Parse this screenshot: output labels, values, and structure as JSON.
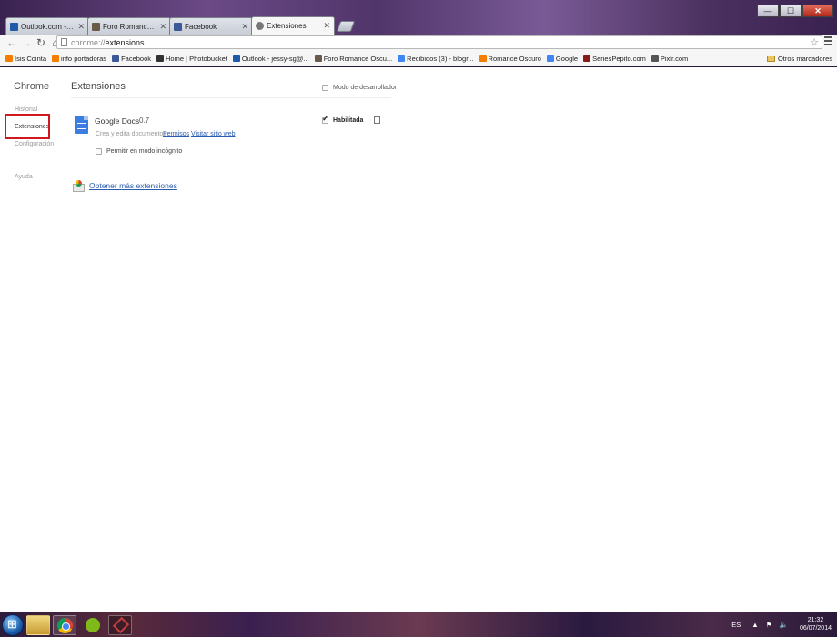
{
  "window": {
    "controls": [
      "—",
      "☐",
      "✕"
    ]
  },
  "tabs": [
    {
      "title": "Outlook.com - jessy-sg@...",
      "icon": "outlook-icon",
      "color": "#1e5aa8",
      "active": false
    },
    {
      "title": "Foro Romance Oscuro - N...",
      "icon": "forum-icon",
      "color": "#6a5a4a",
      "active": false
    },
    {
      "title": "Facebook",
      "icon": "facebook-icon",
      "color": "#3b5998",
      "active": false
    },
    {
      "title": "Extensiones",
      "icon": "puzzle-icon",
      "color": "#777777",
      "active": true
    }
  ],
  "toolbar": {
    "url_scheme": "chrome://",
    "url_path": "extensions"
  },
  "bookmarks": [
    {
      "label": "Isis Cointa",
      "icon": "blogger-icon",
      "color": "#f57d00"
    },
    {
      "label": "info portadoras",
      "icon": "blogger-icon",
      "color": "#f57d00"
    },
    {
      "label": "Facebook",
      "icon": "facebook-icon",
      "color": "#3b5998"
    },
    {
      "label": "Home | Photobucket",
      "icon": "photobucket-icon",
      "color": "#333333"
    },
    {
      "label": "Outlook - jessy-sg@...",
      "icon": "outlook-icon",
      "color": "#1e5aa8"
    },
    {
      "label": "Foro Romance Oscu...",
      "icon": "forum-icon",
      "color": "#6a5a4a"
    },
    {
      "label": "Recibidos (3) - blogr...",
      "icon": "google-icon",
      "color": "#4285f4"
    },
    {
      "label": "Romance Oscuro",
      "icon": "blogger-icon",
      "color": "#f57d00"
    },
    {
      "label": "Google",
      "icon": "google-icon",
      "color": "#4285f4"
    },
    {
      "label": "SeriesPepito.com",
      "icon": "seriespepito-icon",
      "color": "#8a1a1a"
    },
    {
      "label": "Pixlr.com",
      "icon": "pixlr-icon",
      "color": "#555555"
    }
  ],
  "bookmarks_other": "Otros marcadores",
  "sidebar": {
    "title": "Chrome",
    "items": [
      "Historial",
      "Extensiones",
      "Configuración",
      "Ayuda"
    ],
    "active": "Extensiones"
  },
  "main": {
    "title": "Extensiones",
    "dev_mode_label": "Modo de desarrollador",
    "extension": {
      "name": "Google Docs",
      "version": "0.7",
      "description": "Crea y edita documentos",
      "permissions_link": "Permisos",
      "website_link": "Visitar sitio web",
      "incognito_label": "Permitir en modo incógnito",
      "enabled_label": "Habilitada",
      "enabled": true
    },
    "get_more_link": "Obtener más extensiones"
  },
  "taskbar": {
    "language": "ES",
    "time": "21:32",
    "date": "06/07/2014"
  }
}
